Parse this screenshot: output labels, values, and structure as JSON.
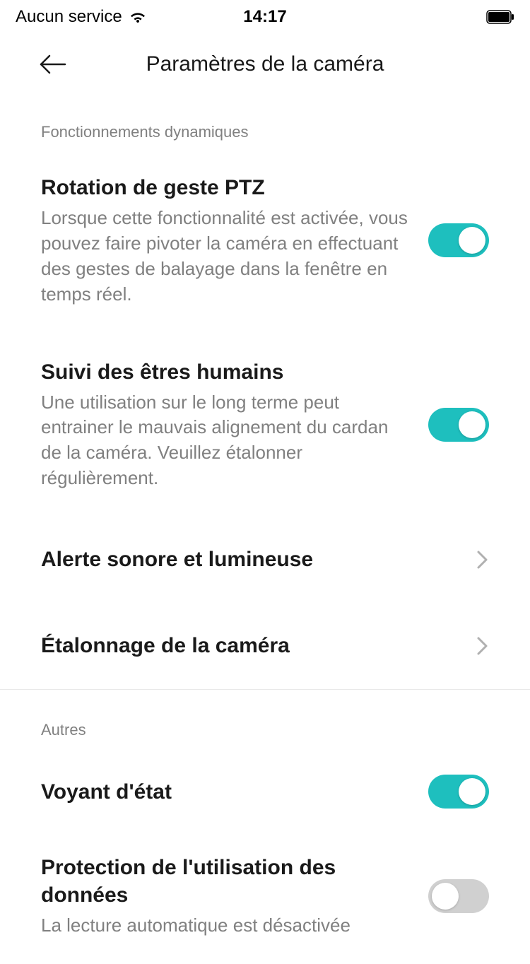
{
  "statusBar": {
    "service": "Aucun service",
    "time": "14:17"
  },
  "nav": {
    "title": "Paramètres de la caméra"
  },
  "sections": {
    "dynamic": {
      "header": "Fonctionnements dynamiques",
      "ptz": {
        "title": "Rotation de geste PTZ",
        "desc": "Lorsque cette fonctionnalité est activée, vous pouvez faire pivoter la caméra en effectuant des gestes de balayage dans la fenêtre en temps réel.",
        "enabled": true
      },
      "tracking": {
        "title": "Suivi des êtres humains",
        "desc": "Une utilisation sur le long terme peut entrainer le mauvais alignement du cardan de la caméra. Veuillez étalonner régulièrement.",
        "enabled": true
      },
      "alert": {
        "title": "Alerte sonore et lumineuse"
      },
      "calibration": {
        "title": "Étalonnage de la caméra"
      }
    },
    "other": {
      "header": "Autres",
      "statusLight": {
        "title": "Voyant d'état",
        "enabled": true
      },
      "dataProtection": {
        "title": "Protection de l'utilisation des données",
        "desc": "La lecture automatique est désactivée",
        "enabled": false
      }
    }
  },
  "colors": {
    "accent": "#1ebfbe"
  }
}
